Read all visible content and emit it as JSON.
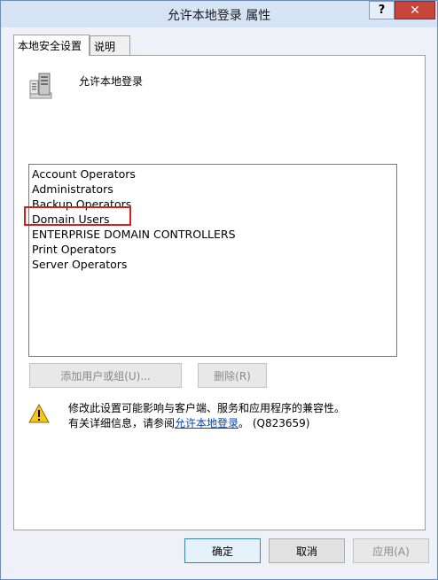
{
  "window": {
    "title": "允许本地登录 属性",
    "help_label": "?",
    "close_label": "✕"
  },
  "tabs": [
    {
      "label": "本地安全设置",
      "active": true
    },
    {
      "label": "说明",
      "active": false
    }
  ],
  "policy": {
    "name": "允许本地登录",
    "icon": "server-policy-icon"
  },
  "members": [
    "Account Operators",
    "Administrators",
    "Backup Operators",
    "Domain Users",
    "ENTERPRISE DOMAIN CONTROLLERS",
    "Print Operators",
    "Server Operators"
  ],
  "highlighted_member": "Domain Users",
  "highlight_color": "#d32020",
  "actions": {
    "add_label": "添加用户或组(U)...",
    "remove_label": "删除(R)"
  },
  "warning": {
    "icon": "warning-icon",
    "line1": "修改此设置可能影响与客户端、服务和应用程序的兼容性。",
    "line2_prefix": "有关详细信息，请参阅",
    "link_text": "允许本地登录",
    "line2_suffix": "。 (Q823659)"
  },
  "footer": {
    "ok_label": "确定",
    "cancel_label": "取消",
    "apply_label": "应用(A)"
  }
}
